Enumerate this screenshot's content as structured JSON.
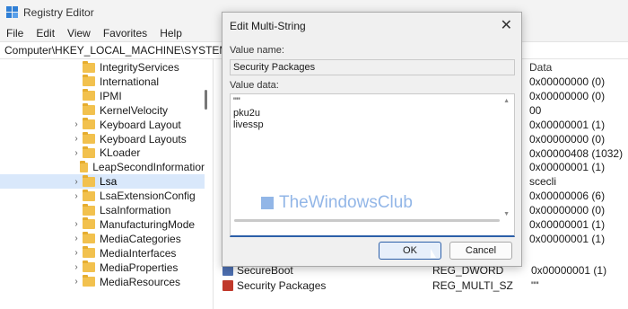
{
  "window": {
    "title": "Registry Editor"
  },
  "menu": [
    "File",
    "Edit",
    "View",
    "Favorites",
    "Help"
  ],
  "address": "Computer\\HKEY_LOCAL_MACHINE\\SYSTEM\\Currer",
  "tree": [
    {
      "label": "IntegrityServices",
      "expandable": false,
      "selected": false
    },
    {
      "label": "International",
      "expandable": false,
      "selected": false
    },
    {
      "label": "IPMI",
      "expandable": false,
      "selected": false
    },
    {
      "label": "KernelVelocity",
      "expandable": false,
      "selected": false
    },
    {
      "label": "Keyboard Layout",
      "expandable": true,
      "selected": false
    },
    {
      "label": "Keyboard Layouts",
      "expandable": true,
      "selected": false
    },
    {
      "label": "KLoader",
      "expandable": true,
      "selected": false
    },
    {
      "label": "LeapSecondInformatior",
      "expandable": false,
      "selected": false
    },
    {
      "label": "Lsa",
      "expandable": true,
      "selected": true
    },
    {
      "label": "LsaExtensionConfig",
      "expandable": true,
      "selected": false
    },
    {
      "label": "LsaInformation",
      "expandable": false,
      "selected": false
    },
    {
      "label": "ManufacturingMode",
      "expandable": true,
      "selected": false
    },
    {
      "label": "MediaCategories",
      "expandable": true,
      "selected": false
    },
    {
      "label": "MediaInterfaces",
      "expandable": true,
      "selected": false
    },
    {
      "label": "MediaProperties",
      "expandable": true,
      "selected": false
    },
    {
      "label": "MediaResources",
      "expandable": true,
      "selected": false
    }
  ],
  "right_pane": {
    "data_header": "Data",
    "data_values": [
      "0x00000000 (0)",
      "0x00000000 (0)",
      "00",
      "0x00000001 (1)",
      "0x00000000 (0)",
      "0x00000408 (1032)",
      "0x00000001 (1)",
      "scecli",
      "0x00000006 (6)",
      "0x00000000 (0)",
      "0x00000001 (1)",
      "0x00000001 (1)"
    ],
    "rows": [
      {
        "name": "SecureBoot",
        "type": "REG_DWORD",
        "data": "0x00000001 (1)",
        "icon": "dword"
      },
      {
        "name": "Security Packages",
        "type": "REG_MULTI_SZ",
        "data": "\"\"",
        "icon": "string"
      }
    ]
  },
  "dialog": {
    "title": "Edit Multi-String",
    "close": "✕",
    "value_name_label": "Value name:",
    "value_name": "Security Packages",
    "value_data_label": "Value data:",
    "value_data_lines": [
      "\"\"",
      "pku2u",
      "livessp"
    ],
    "watermark": "TheWindowsClub",
    "ok_label": "OK",
    "cancel_label": "Cancel"
  },
  "colors": {
    "accent": "#2c5fa8",
    "folder": "#f2c14e",
    "selection": "#d9e8fb"
  }
}
